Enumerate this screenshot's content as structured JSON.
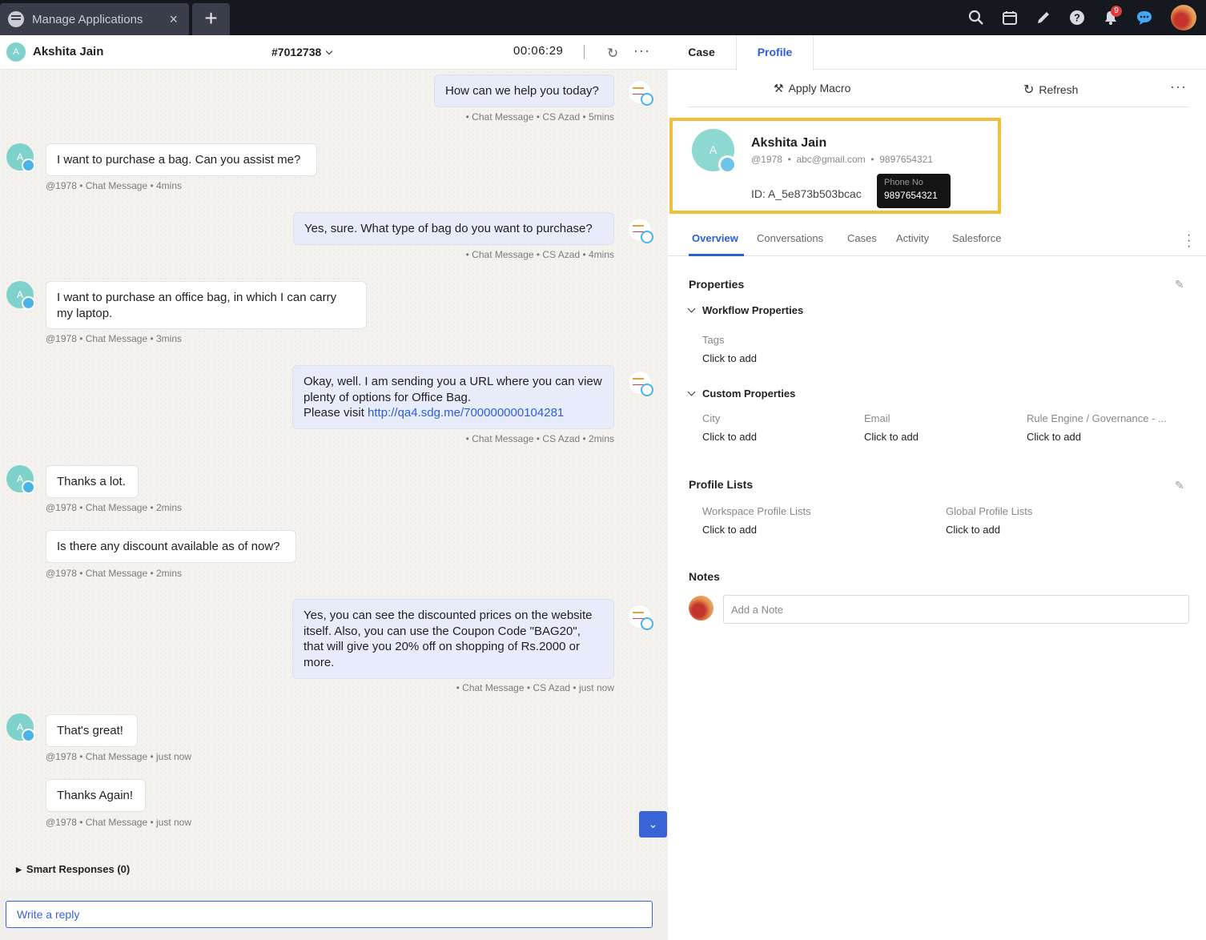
{
  "topbar": {
    "tab_title": "Manage Applications",
    "close_glyph": "×",
    "new_tab_glyph": "+",
    "notification_count": "9",
    "icons": [
      "search-icon",
      "calendar-icon",
      "pencil-icon",
      "help-icon",
      "bell-icon",
      "chat-icon",
      "user-avatar"
    ]
  },
  "conversation": {
    "customer_name": "Akshita Jain",
    "avatar_letter": "A",
    "case_number": "#7012738",
    "timer": "00:06:29"
  },
  "right_tabs": [
    "Case",
    "Profile"
  ],
  "messages": [
    {
      "dir": "out",
      "text": "How can we help you today?",
      "meta": "• Chat Message • CS Azad • 5mins"
    },
    {
      "dir": "in",
      "text": "I want to purchase a bag. Can you assist me?",
      "meta": "@1978 • Chat Message • 4mins"
    },
    {
      "dir": "out",
      "text": "Yes, sure. What type of bag do you want to purchase?",
      "meta": "• Chat Message • CS Azad • 4mins"
    },
    {
      "dir": "in",
      "text": "I want to purchase an office bag, in which I can carry my laptop.",
      "meta": "@1978 • Chat Message • 3mins"
    },
    {
      "dir": "out",
      "text": "Okay, well. I am sending you a URL where you can view plenty of options for Office Bag.",
      "text2": "Please visit ",
      "link": "http://qa4.sdg.me/700000000104281",
      "meta": "• Chat Message • CS Azad • 2mins"
    },
    {
      "dir": "in",
      "text": "Thanks a lot.",
      "meta": "@1978 • Chat Message • 2mins"
    },
    {
      "dir": "in",
      "text": "Is there any discount available as of now?",
      "meta": "@1978 • Chat Message • 2mins"
    },
    {
      "dir": "out",
      "text": "Yes, you can see the discounted prices on the website itself. Also, you can use the Coupon Code \"BAG20\", that will give you 20% off on shopping of Rs.2000 or more.",
      "meta": "• Chat Message • CS Azad • just now"
    },
    {
      "dir": "in",
      "text": "That's great!",
      "meta": "@1978 • Chat Message • just now"
    },
    {
      "dir": "in",
      "text": "Thanks Again!",
      "meta": "@1978 • Chat Message • just now"
    }
  ],
  "smart_responses": "Smart Responses (0)",
  "reply_placeholder": "Write a reply",
  "profile": {
    "apply_macro": "Apply Macro",
    "refresh": "Refresh",
    "name": "Akshita Jain",
    "avatar_letter": "A",
    "handle": "@1978",
    "email": "abc@gmail.com",
    "phone": "9897654321",
    "id": "ID: A_5e873b503bcac",
    "tooltip_label": "Phone No",
    "tooltip_value": "9897654321",
    "tabs": [
      "Overview",
      "Conversations",
      "Cases",
      "Activity",
      "Salesforce"
    ],
    "properties_title": "Properties",
    "workflow_title": "Workflow Properties",
    "tags_label": "Tags",
    "custom_title": "Custom Properties",
    "custom_fields": [
      {
        "label": "City",
        "value": "Click to add"
      },
      {
        "label": "Email",
        "value": "Click to add"
      },
      {
        "label": "Rule Engine / Governance - ...",
        "value": "Click to add"
      }
    ],
    "profile_lists_title": "Profile Lists",
    "lists": [
      {
        "label": "Workspace Profile Lists",
        "value": "Click to add"
      },
      {
        "label": "Global Profile Lists",
        "value": "Click to add"
      }
    ],
    "click_to_add": "Click to add",
    "notes_title": "Notes",
    "note_placeholder": "Add a Note"
  }
}
